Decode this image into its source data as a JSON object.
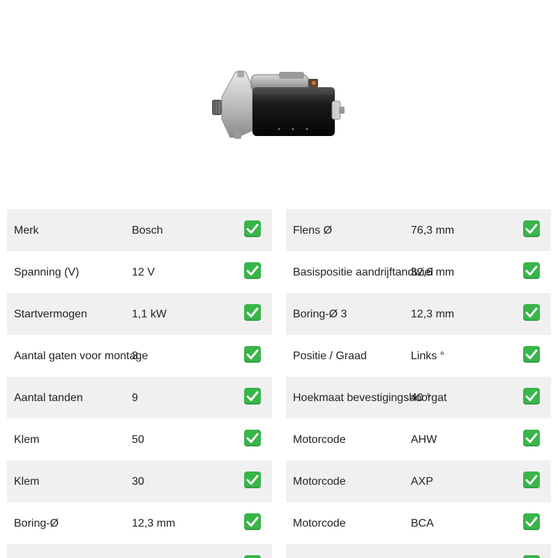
{
  "product": {
    "image_icon": "starter-motor-photo"
  },
  "specs_left": [
    {
      "label": "Merk",
      "value": "Bosch",
      "checked": true
    },
    {
      "label": "Spanning (V)",
      "value": "12 V",
      "checked": true
    },
    {
      "label": "Startvermogen",
      "value": "1,1 kW",
      "checked": true
    },
    {
      "label": "Aantal gaten voor montage",
      "value": "3",
      "checked": true
    },
    {
      "label": "Aantal tanden",
      "value": "9",
      "checked": true
    },
    {
      "label": "Klem",
      "value": "50",
      "checked": true
    },
    {
      "label": "Klem",
      "value": "30",
      "checked": true
    },
    {
      "label": "Boring-Ø",
      "value": "12,3 mm",
      "checked": true
    },
    {
      "label": "",
      "value": "",
      "checked": true
    }
  ],
  "specs_right": [
    {
      "label": "Flens Ø",
      "value": "76,3 mm",
      "checked": true
    },
    {
      "label": "Basispositie aandrijftandwiel",
      "value": "32,6 mm",
      "checked": true
    },
    {
      "label": "Boring-Ø 3",
      "value": "12,3 mm",
      "checked": true
    },
    {
      "label": "Positie / Graad",
      "value": "Links °",
      "checked": true
    },
    {
      "label": "Hoekmaat bevestigingsboorgat",
      "value": "40 °",
      "checked": true
    },
    {
      "label": "Motorcode",
      "value": "AHW",
      "checked": true
    },
    {
      "label": "Motorcode",
      "value": "AXP",
      "checked": true
    },
    {
      "label": "Motorcode",
      "value": "BCA",
      "checked": true
    },
    {
      "label": "",
      "value": "",
      "checked": true
    }
  ],
  "colors": {
    "row_alt": "#f0f0f0",
    "check_bg": "#39b54a",
    "check_mark": "#ffffff"
  }
}
